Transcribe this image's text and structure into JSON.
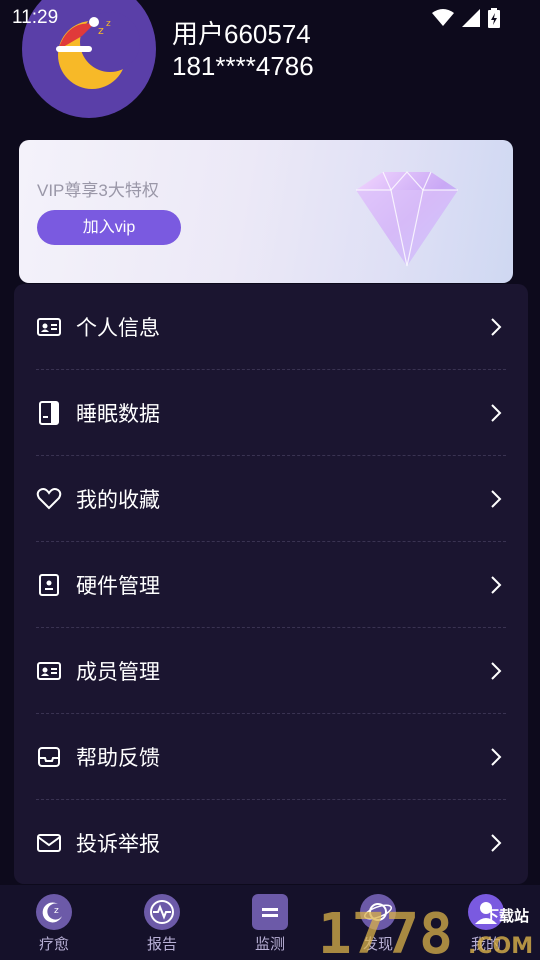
{
  "status": {
    "time": "11:29"
  },
  "profile": {
    "name": "用户660574",
    "phone": "181****4786"
  },
  "vip": {
    "text": "VIP尊享3大特权",
    "button": "加入vip",
    "accent": "#7a5ae0"
  },
  "menu": [
    {
      "label": "个人信息",
      "icon": "id-card-icon"
    },
    {
      "label": "睡眠数据",
      "icon": "document-icon"
    },
    {
      "label": "我的收藏",
      "icon": "heart-icon"
    },
    {
      "label": "硬件管理",
      "icon": "device-icon"
    },
    {
      "label": "成员管理",
      "icon": "members-card-icon"
    },
    {
      "label": "帮助反馈",
      "icon": "inbox-icon"
    },
    {
      "label": "投诉举报",
      "icon": "mail-icon"
    }
  ],
  "tabs": [
    {
      "label": "疗愈",
      "icon": "moon-z-icon"
    },
    {
      "label": "报告",
      "icon": "pulse-icon"
    },
    {
      "label": "监测",
      "icon": "monitor-icon"
    },
    {
      "label": "发现",
      "icon": "planet-icon"
    },
    {
      "label": "我的",
      "icon": "profile-icon"
    }
  ],
  "watermark": {
    "text": "1778",
    "suffix": ".COM",
    "badge": "下载站"
  }
}
